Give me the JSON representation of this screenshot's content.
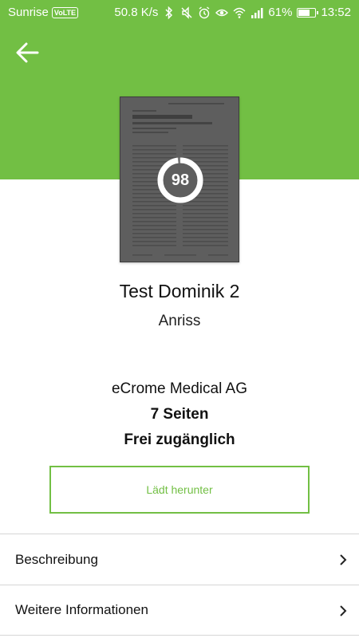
{
  "status_bar": {
    "carrier": "Sunrise",
    "network_badge": "VoLTE",
    "speed": "50.8 K/s",
    "battery": "61%",
    "battery_level": 0.61,
    "time": "13:52"
  },
  "colors": {
    "accent": "#72bf44"
  },
  "document": {
    "score": "98",
    "score_fraction": 0.98,
    "title": "Test Dominik 2",
    "subtitle": "Anriss",
    "publisher": "eCrome Medical AG",
    "pages": "7 Seiten",
    "access": "Frei zugänglich"
  },
  "actions": {
    "download_label": "Lädt herunter"
  },
  "sections": [
    {
      "label": "Beschreibung",
      "icon": "chevron-right-icon"
    },
    {
      "label": "Weitere Informationen",
      "icon": "chevron-right-icon"
    }
  ]
}
